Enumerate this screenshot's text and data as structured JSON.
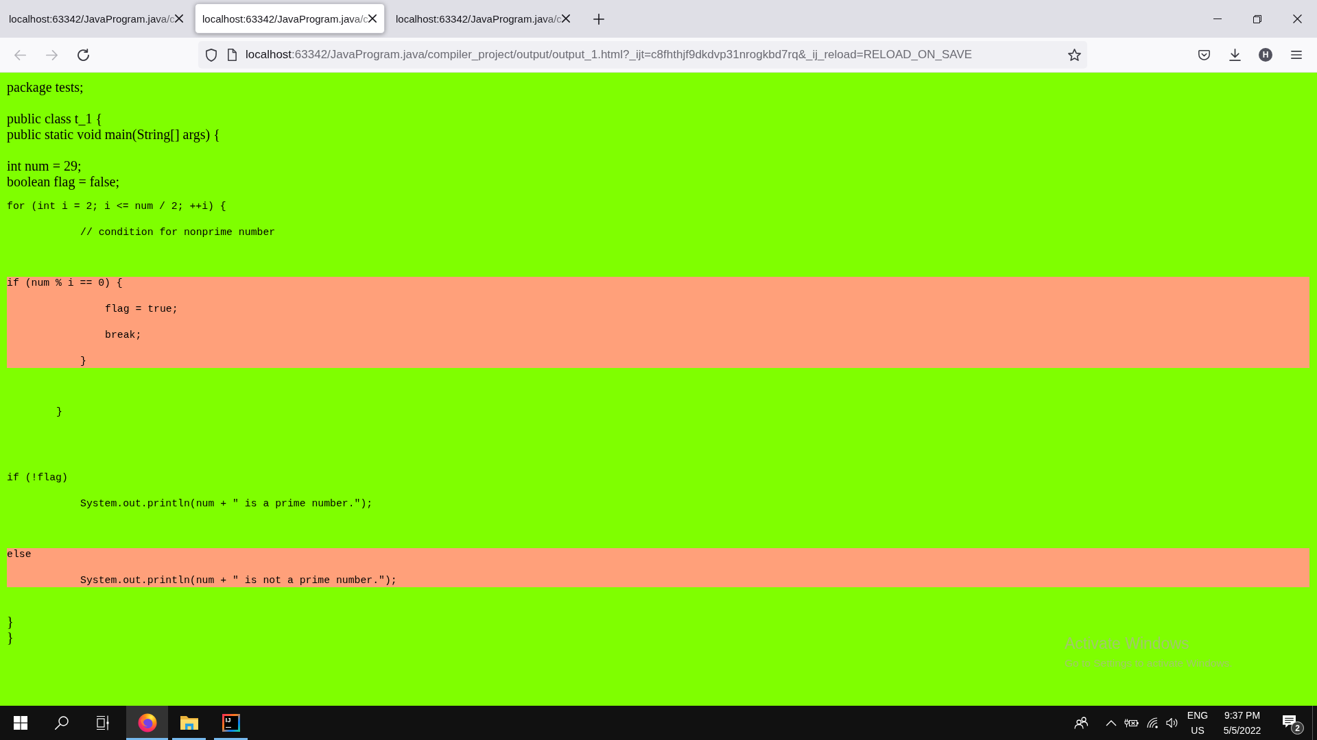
{
  "browser": {
    "tabs": [
      {
        "title": "localhost:63342/JavaProgram.java/c",
        "selected": false
      },
      {
        "title": "localhost:63342/JavaProgram.java/c",
        "selected": true
      },
      {
        "title": "localhost:63342/JavaProgram.java/c",
        "selected": false
      }
    ],
    "nav_buttons": [
      {
        "kind": "back",
        "disabled": true
      },
      {
        "kind": "forward",
        "disabled": true
      },
      {
        "kind": "reload",
        "disabled": false
      }
    ],
    "address_bar": {
      "host": "localhost",
      "rest": ":63342/JavaProgram.java/compiler_project/output/output_1.html?_ijt=c8fhthjf9dkdvp31nrogkbd7rq&_ij_reload=RELOAD_ON_SAVE"
    },
    "account_initial": "H"
  },
  "page": {
    "blocks": [
      {
        "kind": "text",
        "highlighted": false,
        "lines": [
          "package tests;"
        ]
      },
      {
        "kind": "text",
        "highlighted": false,
        "lines": [
          "public class t_1 {",
          "public static void main(String[] args) {"
        ]
      },
      {
        "kind": "text",
        "highlighted": false,
        "lines": [
          "int num = 29;",
          "boolean flag = false;"
        ]
      },
      {
        "kind": "code",
        "highlighted": false,
        "lines": [
          "for (int i = 2; i <= num / 2; ++i) {",
          "// condition for nonprime number"
        ]
      },
      {
        "kind": "code",
        "highlighted": true,
        "lines": [
          "if (num % i == 0) {",
          "flag = true;",
          "break;",
          "}"
        ]
      },
      {
        "kind": "code",
        "highlighted": false,
        "lines": [
          "}"
        ]
      },
      {
        "kind": "code",
        "highlighted": false,
        "lines": [
          "if (!flag)",
          "System.out.println(num + \" is a prime number.\");"
        ]
      },
      {
        "kind": "code",
        "highlighted": true,
        "lines": [
          "else",
          "System.out.println(num + \" is not a prime number.\");"
        ]
      },
      {
        "kind": "text",
        "highlighted": false,
        "lines": [
          "}",
          "}"
        ]
      }
    ]
  },
  "activation_notice": {
    "title": "Activate Windows",
    "subtitle": "Go to Settings to activate Windows."
  },
  "taskbar": {
    "apps": [
      {
        "kind": "browser",
        "selected": true
      },
      {
        "kind": "folder",
        "selected": false
      },
      {
        "kind": "ide",
        "selected": false,
        "icon_text": "IJ"
      }
    ],
    "language": "ENG",
    "region": "US",
    "time": "9:37 PM",
    "date": "5/5/2022",
    "notification_count": "2"
  }
}
